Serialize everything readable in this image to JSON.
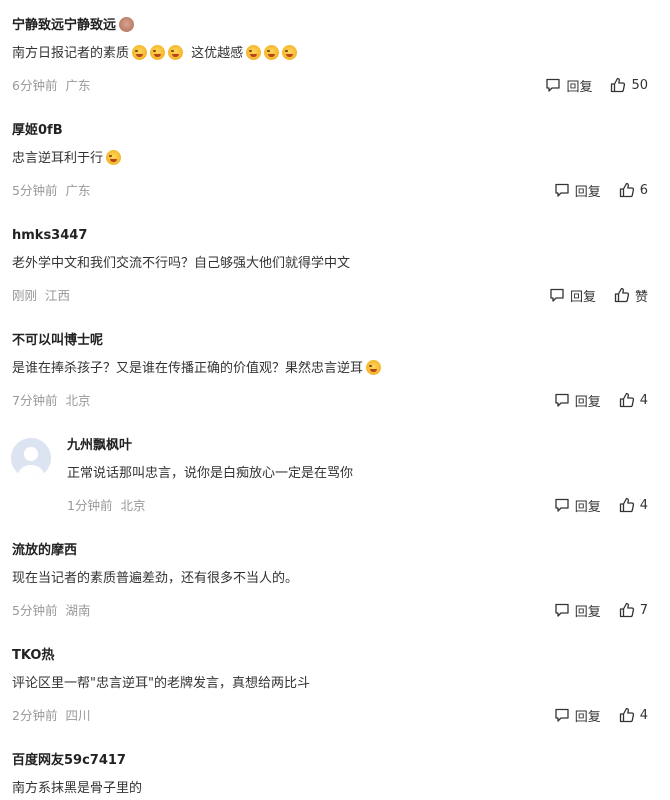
{
  "labels": {
    "reply": "回复"
  },
  "comments": [
    {
      "user": "宁静致远宁静致远",
      "text": "南方日报记者的素质",
      "text2": "这优越感",
      "time": "6分钟前",
      "location": "广东",
      "likes": "50"
    },
    {
      "user": "厚姬0fB",
      "text": "忠言逆耳利于行",
      "time": "5分钟前",
      "location": "广东",
      "likes": "6"
    },
    {
      "user": "hmks3447",
      "text": "老外学中文和我们交流不行吗？自己够强大他们就得学中文",
      "time": "刚刚",
      "location": "江西",
      "likes": "赞"
    },
    {
      "user": "不可以叫博士呢",
      "text": "是谁在捧杀孩子？又是谁在传播正确的价值观？果然忠言逆耳",
      "time": "7分钟前",
      "location": "北京",
      "likes": "4"
    },
    {
      "user": "九州飘枫叶",
      "text": "正常说话那叫忠言，说你是白痴放心一定是在骂你",
      "time": "1分钟前",
      "location": "北京",
      "likes": "4"
    },
    {
      "user": "流放的摩西",
      "text": "现在当记者的素质普遍差劲，还有很多不当人的。",
      "time": "5分钟前",
      "location": "湖南",
      "likes": "7"
    },
    {
      "user": "TKO热",
      "text": "评论区里一帮\"忠言逆耳\"的老牌发言，真想给两比斗",
      "time": "2分钟前",
      "location": "四川",
      "likes": "4"
    },
    {
      "user": "百度网友59c7417",
      "text": "南方系抹黑是骨子里的"
    }
  ]
}
